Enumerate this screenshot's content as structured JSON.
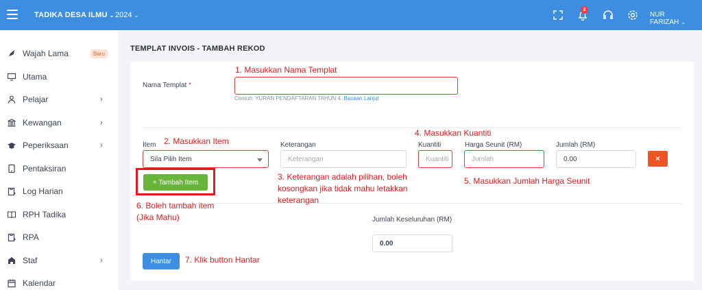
{
  "topbar": {
    "brand": "TADIKA DESA ILMU",
    "year": "2024",
    "notification_count": "2",
    "user": "NUR FARIZAH",
    "chevron": "⌄",
    "bg_color": "#3d8ee0",
    "icons": [
      "menu-icon",
      "fullscreen-icon",
      "bell-icon",
      "headset-icon",
      "gear-icon"
    ]
  },
  "sidebar": {
    "items": [
      {
        "label": "Wajah Lama",
        "icon": "rocket-icon",
        "badge": "Baru"
      },
      {
        "label": "Utama",
        "icon": "monitor-icon"
      },
      {
        "label": "Pelajar",
        "icon": "user-icon",
        "arrow": "›"
      },
      {
        "label": "Kewangan",
        "icon": "bank-icon",
        "arrow": "›"
      },
      {
        "label": "Peperiksaan",
        "icon": "graduation-cap-icon",
        "arrow": "›"
      },
      {
        "label": "Pentaksiran",
        "icon": "tablet-icon"
      },
      {
        "label": "Log Harian",
        "icon": "clipboard-icon"
      },
      {
        "label": "RPH Tadika",
        "icon": "book-icon"
      },
      {
        "label": "RPA",
        "icon": "clipboard-check-icon"
      },
      {
        "label": "Staf",
        "icon": "users-icon",
        "arrow": "›"
      },
      {
        "label": "Kalendar",
        "icon": "calendar-icon"
      }
    ]
  },
  "page": {
    "title": "TEMPLAT INVOIS - TAMBAH REKOD"
  },
  "form": {
    "nama_label": "Nama Templat",
    "required_mark": "*",
    "nama_value": "",
    "hint_text": "Contoh: YURAN PENDAFTARAN TAHUN 4.",
    "hint_link": "Bacaan Lanjut",
    "col_item": "Item",
    "col_keterangan": "Keterangan",
    "col_kuantiti": "Kuantiti",
    "col_harga": "Harga Seunit (RM)",
    "col_jumlah": "Jumlah (RM)",
    "item_select": "Sila Pilih Item",
    "keterangan_placeholder": "Keterangan",
    "kuantiti_placeholder": "Kuantiti",
    "harga_placeholder": "Jumlah",
    "jumlah_value": "0.00",
    "delete_label": "×",
    "add_item_button": "+ Tambah Item",
    "total_label": "Jumlah Keseluruhan (RM)",
    "total_value": "0.00",
    "submit_button": "Hantar"
  },
  "annotations": {
    "a1": "1. Masukkan Nama Templat",
    "a2": "2. Masukkan Item",
    "a3": "3. Keterangan adalah pilihan, boleh kosongkan jika tidak mahu letakkan keterangan",
    "a4": "4. Masukkan Kuantiti",
    "a5": "5. Masukkan Jumlah Harga Seunit",
    "a6": "6. Boleh tambah item (Jika Mahu)",
    "a7": "7. Klik button Hantar",
    "color": "#e8181a"
  }
}
